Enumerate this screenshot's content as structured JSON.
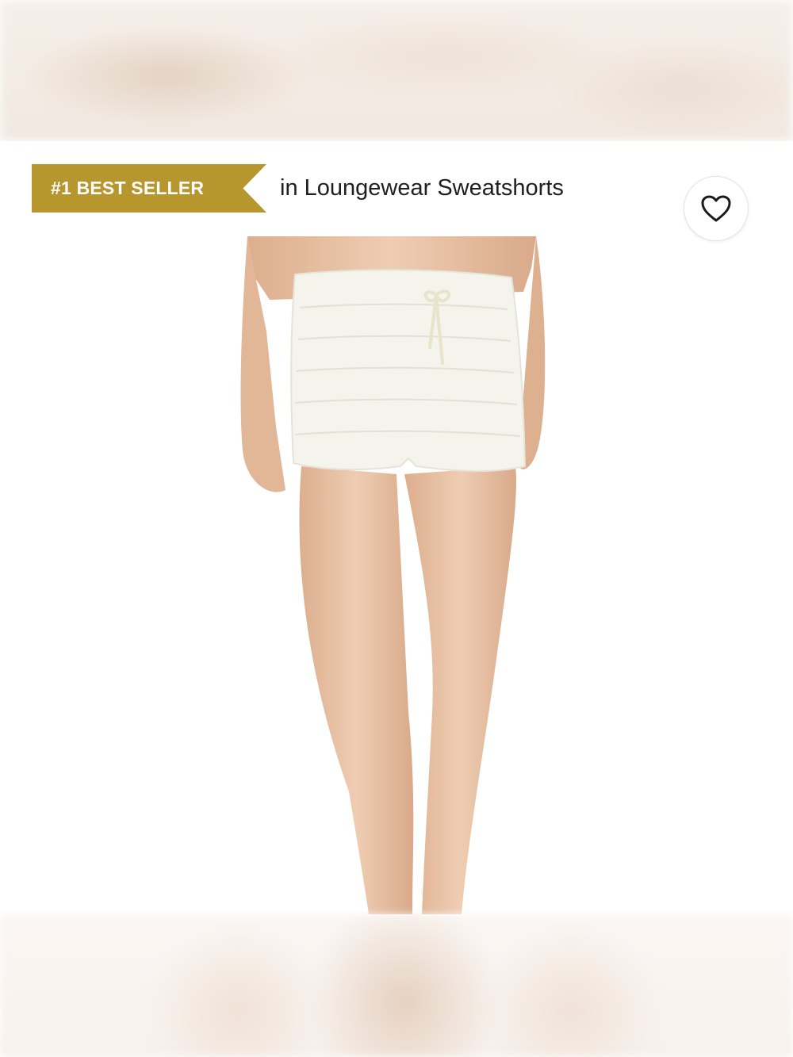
{
  "bestseller": {
    "badge_label": "#1 BEST SELLER",
    "suffix": "in Loungewear Sweatshorts",
    "badge_color": "#b7962e"
  },
  "favorite": {
    "icon": "heart-outline-icon"
  },
  "product": {
    "image": "white-ruffle-shorts-photo",
    "shorts_color": "#f4f3ec",
    "skin_color": "#e9c3a6"
  }
}
